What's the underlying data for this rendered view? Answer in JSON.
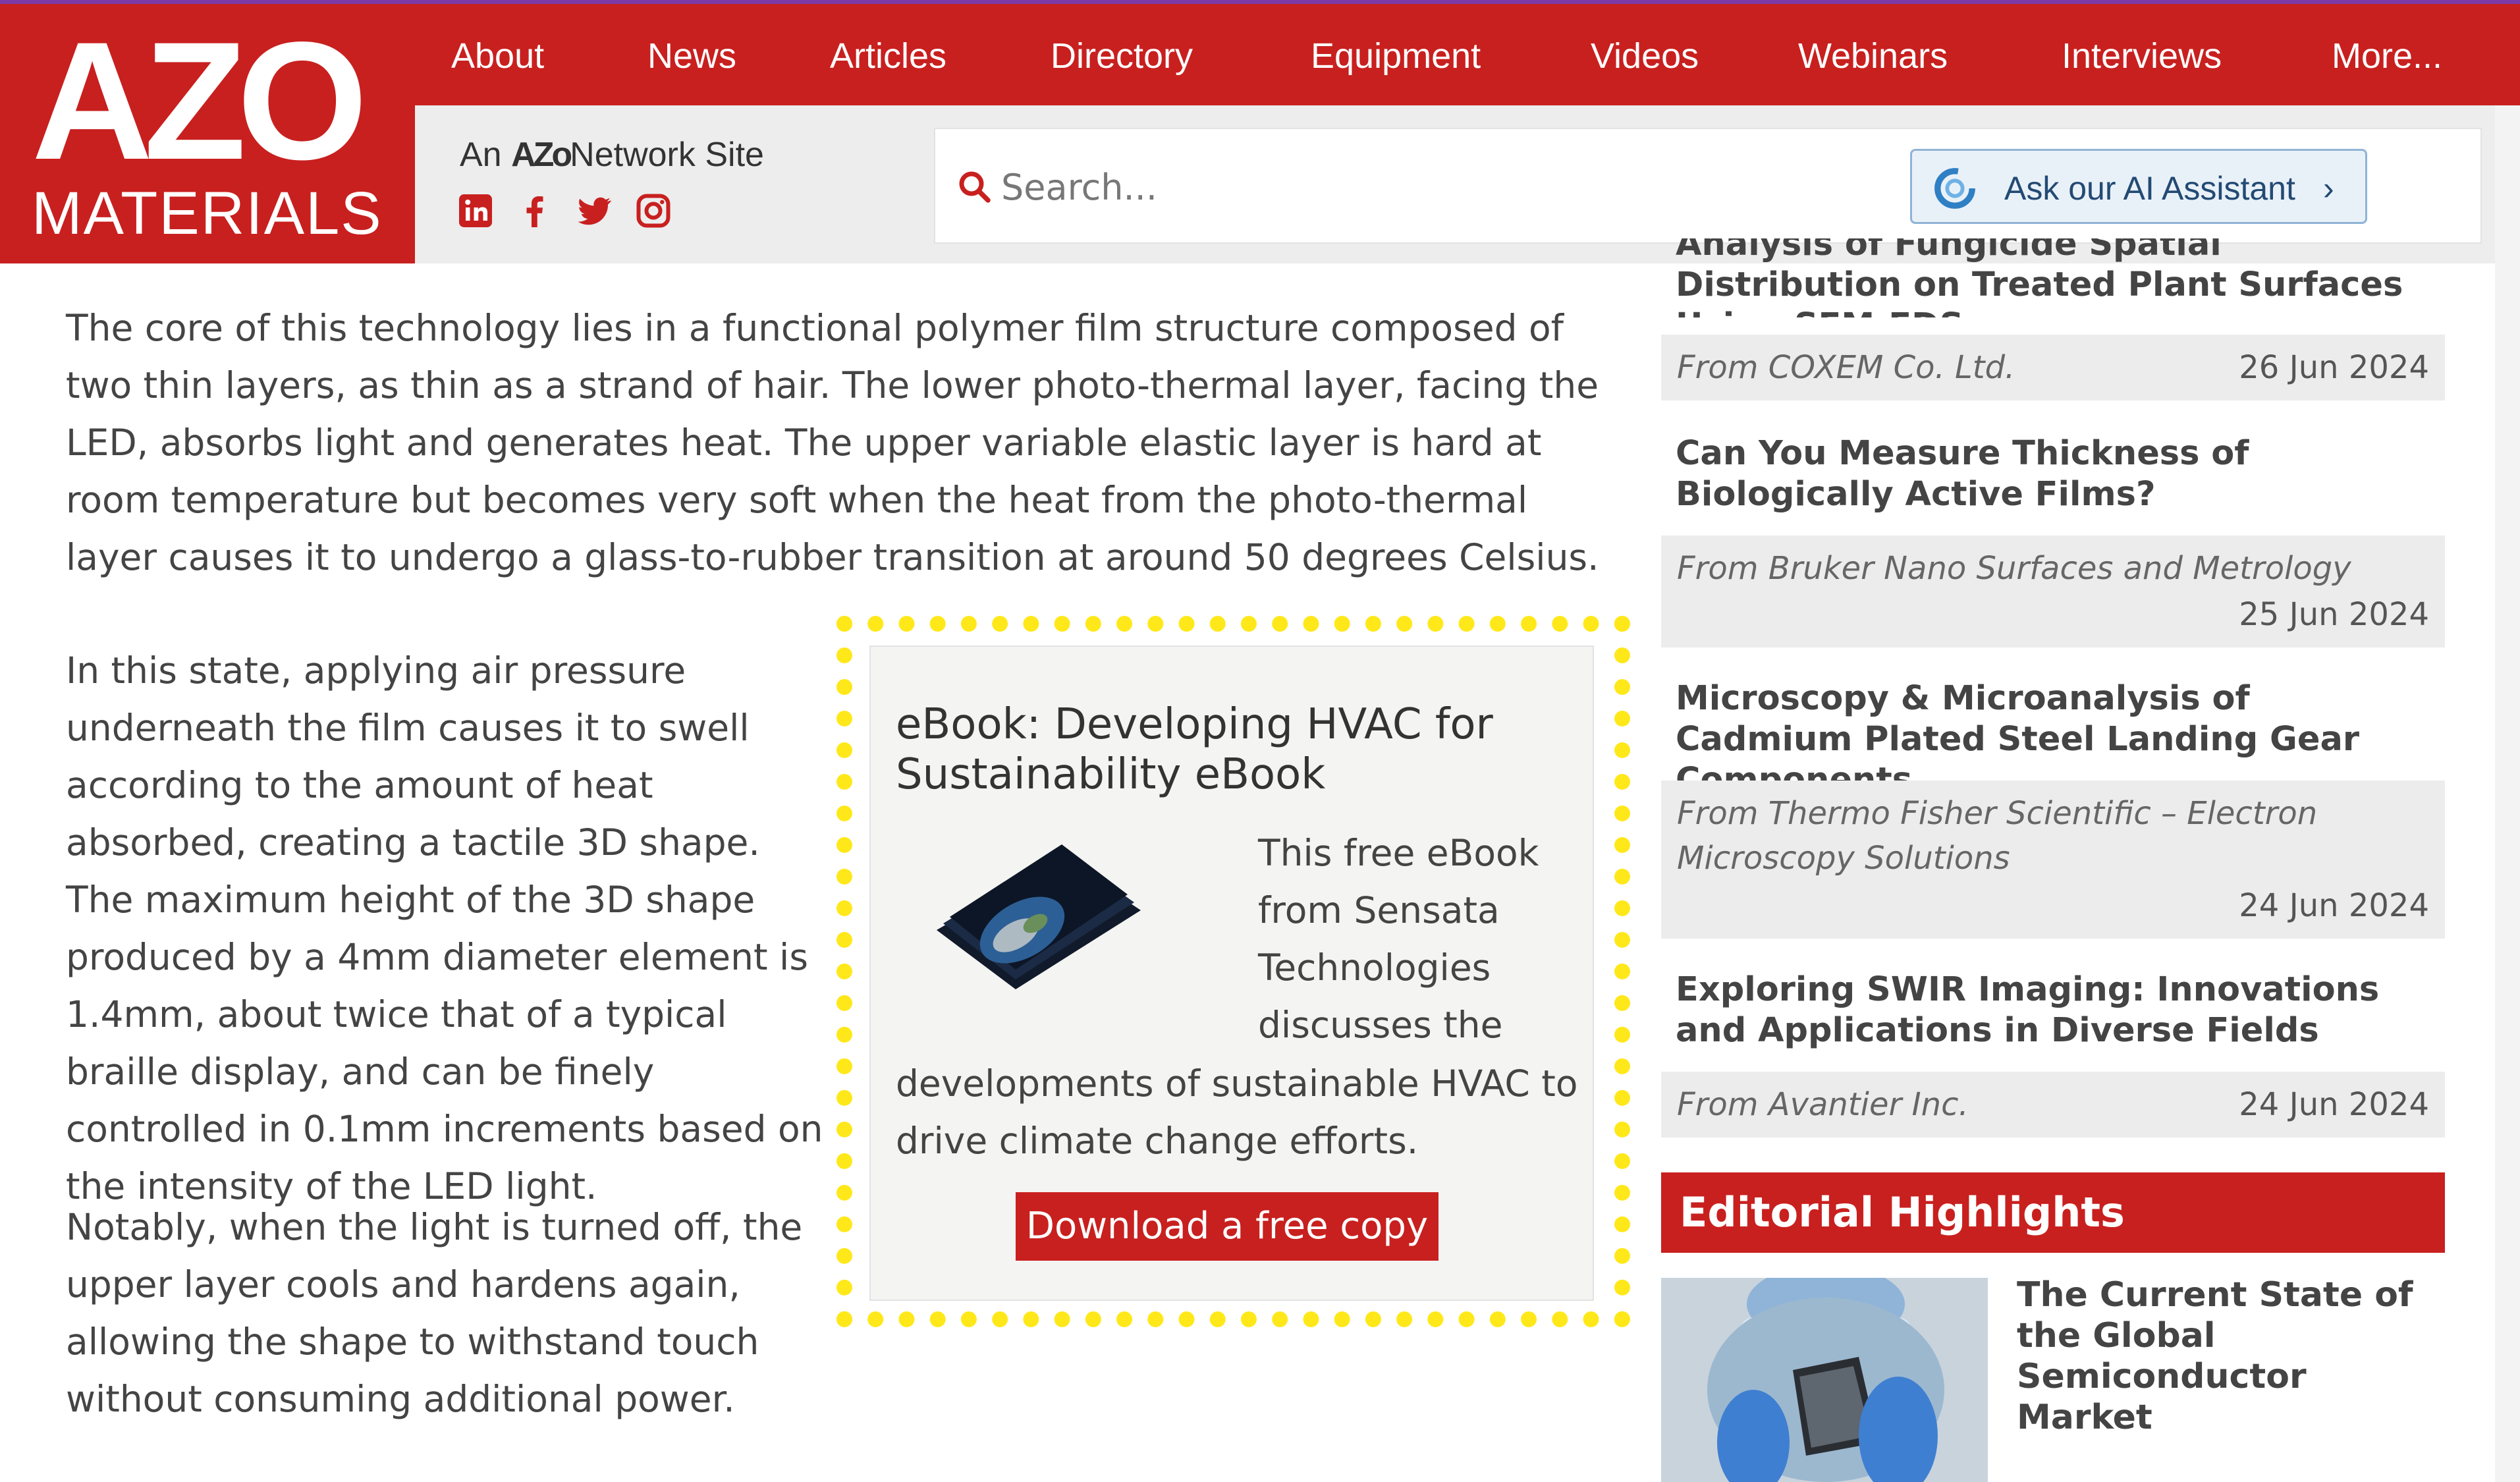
{
  "logo": {
    "top": "AZO",
    "bottom": "MATERIALS"
  },
  "nav": {
    "items": [
      "About",
      "News",
      "Articles",
      "Directory",
      "Equipment",
      "Videos",
      "Webinars",
      "Interviews",
      "More..."
    ]
  },
  "network": {
    "prefix": "An",
    "brand_a": "AZo",
    "brand_b": "Network",
    "suffix": "Site"
  },
  "social": [
    "linkedin-icon",
    "facebook-icon",
    "twitter-icon",
    "instagram-icon"
  ],
  "search": {
    "placeholder": "Search...",
    "value": ""
  },
  "ai_button": {
    "label": "Ask our AI Assistant",
    "chevron": "›"
  },
  "go_button": {
    "label": "›"
  },
  "article": {
    "paragraphs": [
      "The core of this technology lies in a functional polymer film structure composed of two thin layers, as thin as a strand of hair. The lower photo-thermal layer, facing the LED, absorbs light and generates heat. The upper variable elastic layer is hard at room temperature but becomes very soft when the heat from the photo-thermal layer causes it to undergo a glass-to-rubber transition at around 50 degrees Celsius.",
      "In this state, applying air pressure underneath the film causes it to swell according to the amount of heat absorbed, creating a tactile 3D shape. The maximum height of the 3D shape produced by a 4mm diameter element is 1.4mm, about twice that of a typical braille display, and can be finely controlled in 0.1mm increments based on the intensity of the LED light.",
      "Notably, when the light is turned off, the upper layer cools and hardens again, allowing the shape to withstand touch without consuming additional power."
    ]
  },
  "promo": {
    "title": "eBook: Developing HVAC for Sustainability eBook",
    "text_right": "This free eBook from Sensata Technologies discusses the",
    "text_bottom": "developments of sustainable HVAC to drive climate change efforts.",
    "button": "Download a free copy"
  },
  "sidebar": {
    "articles": [
      {
        "title": "Analysis of Fungicide Spatial Distribution on Treated Plant Surfaces Using SEM-EDS",
        "from": "From COXEM Co. Ltd.",
        "date": "26 Jun 2024"
      },
      {
        "title": "Can You Measure Thickness of Biologically Active Films?",
        "from": "From Bruker Nano Surfaces and Metrology",
        "date": "25 Jun 2024"
      },
      {
        "title": "Microscopy & Microanalysis of Cadmium Plated Steel Landing Gear Components",
        "from": "From Thermo Fisher Scientific – Electron Microscopy Solutions",
        "date": "24 Jun 2024"
      },
      {
        "title": "Exploring SWIR Imaging: Innovations and Applications in Diverse Fields",
        "from": "From Avantier Inc.",
        "date": "24 Jun 2024"
      }
    ],
    "editorial": {
      "heading": "Editorial Highlights",
      "title": "The Current State of the Global Semiconductor Market"
    }
  },
  "colors": {
    "brand_red": "#c8201f",
    "header_gray": "#ededed",
    "highlight_yellow": "#ffe81a",
    "ai_blue": "#234a74"
  }
}
